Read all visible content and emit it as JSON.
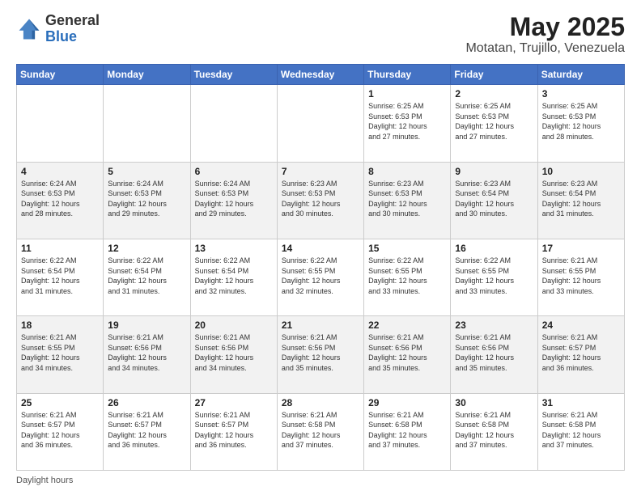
{
  "header": {
    "logo_general": "General",
    "logo_blue": "Blue",
    "title": "May 2025",
    "subtitle": "Motatan, Trujillo, Venezuela"
  },
  "days_of_week": [
    "Sunday",
    "Monday",
    "Tuesday",
    "Wednesday",
    "Thursday",
    "Friday",
    "Saturday"
  ],
  "weeks": [
    [
      {
        "day": "",
        "info": ""
      },
      {
        "day": "",
        "info": ""
      },
      {
        "day": "",
        "info": ""
      },
      {
        "day": "",
        "info": ""
      },
      {
        "day": "1",
        "info": "Sunrise: 6:25 AM\nSunset: 6:53 PM\nDaylight: 12 hours\nand 27 minutes."
      },
      {
        "day": "2",
        "info": "Sunrise: 6:25 AM\nSunset: 6:53 PM\nDaylight: 12 hours\nand 27 minutes."
      },
      {
        "day": "3",
        "info": "Sunrise: 6:25 AM\nSunset: 6:53 PM\nDaylight: 12 hours\nand 28 minutes."
      }
    ],
    [
      {
        "day": "4",
        "info": "Sunrise: 6:24 AM\nSunset: 6:53 PM\nDaylight: 12 hours\nand 28 minutes."
      },
      {
        "day": "5",
        "info": "Sunrise: 6:24 AM\nSunset: 6:53 PM\nDaylight: 12 hours\nand 29 minutes."
      },
      {
        "day": "6",
        "info": "Sunrise: 6:24 AM\nSunset: 6:53 PM\nDaylight: 12 hours\nand 29 minutes."
      },
      {
        "day": "7",
        "info": "Sunrise: 6:23 AM\nSunset: 6:53 PM\nDaylight: 12 hours\nand 30 minutes."
      },
      {
        "day": "8",
        "info": "Sunrise: 6:23 AM\nSunset: 6:53 PM\nDaylight: 12 hours\nand 30 minutes."
      },
      {
        "day": "9",
        "info": "Sunrise: 6:23 AM\nSunset: 6:54 PM\nDaylight: 12 hours\nand 30 minutes."
      },
      {
        "day": "10",
        "info": "Sunrise: 6:23 AM\nSunset: 6:54 PM\nDaylight: 12 hours\nand 31 minutes."
      }
    ],
    [
      {
        "day": "11",
        "info": "Sunrise: 6:22 AM\nSunset: 6:54 PM\nDaylight: 12 hours\nand 31 minutes."
      },
      {
        "day": "12",
        "info": "Sunrise: 6:22 AM\nSunset: 6:54 PM\nDaylight: 12 hours\nand 31 minutes."
      },
      {
        "day": "13",
        "info": "Sunrise: 6:22 AM\nSunset: 6:54 PM\nDaylight: 12 hours\nand 32 minutes."
      },
      {
        "day": "14",
        "info": "Sunrise: 6:22 AM\nSunset: 6:55 PM\nDaylight: 12 hours\nand 32 minutes."
      },
      {
        "day": "15",
        "info": "Sunrise: 6:22 AM\nSunset: 6:55 PM\nDaylight: 12 hours\nand 33 minutes."
      },
      {
        "day": "16",
        "info": "Sunrise: 6:22 AM\nSunset: 6:55 PM\nDaylight: 12 hours\nand 33 minutes."
      },
      {
        "day": "17",
        "info": "Sunrise: 6:21 AM\nSunset: 6:55 PM\nDaylight: 12 hours\nand 33 minutes."
      }
    ],
    [
      {
        "day": "18",
        "info": "Sunrise: 6:21 AM\nSunset: 6:55 PM\nDaylight: 12 hours\nand 34 minutes."
      },
      {
        "day": "19",
        "info": "Sunrise: 6:21 AM\nSunset: 6:56 PM\nDaylight: 12 hours\nand 34 minutes."
      },
      {
        "day": "20",
        "info": "Sunrise: 6:21 AM\nSunset: 6:56 PM\nDaylight: 12 hours\nand 34 minutes."
      },
      {
        "day": "21",
        "info": "Sunrise: 6:21 AM\nSunset: 6:56 PM\nDaylight: 12 hours\nand 35 minutes."
      },
      {
        "day": "22",
        "info": "Sunrise: 6:21 AM\nSunset: 6:56 PM\nDaylight: 12 hours\nand 35 minutes."
      },
      {
        "day": "23",
        "info": "Sunrise: 6:21 AM\nSunset: 6:56 PM\nDaylight: 12 hours\nand 35 minutes."
      },
      {
        "day": "24",
        "info": "Sunrise: 6:21 AM\nSunset: 6:57 PM\nDaylight: 12 hours\nand 36 minutes."
      }
    ],
    [
      {
        "day": "25",
        "info": "Sunrise: 6:21 AM\nSunset: 6:57 PM\nDaylight: 12 hours\nand 36 minutes."
      },
      {
        "day": "26",
        "info": "Sunrise: 6:21 AM\nSunset: 6:57 PM\nDaylight: 12 hours\nand 36 minutes."
      },
      {
        "day": "27",
        "info": "Sunrise: 6:21 AM\nSunset: 6:57 PM\nDaylight: 12 hours\nand 36 minutes."
      },
      {
        "day": "28",
        "info": "Sunrise: 6:21 AM\nSunset: 6:58 PM\nDaylight: 12 hours\nand 37 minutes."
      },
      {
        "day": "29",
        "info": "Sunrise: 6:21 AM\nSunset: 6:58 PM\nDaylight: 12 hours\nand 37 minutes."
      },
      {
        "day": "30",
        "info": "Sunrise: 6:21 AM\nSunset: 6:58 PM\nDaylight: 12 hours\nand 37 minutes."
      },
      {
        "day": "31",
        "info": "Sunrise: 6:21 AM\nSunset: 6:58 PM\nDaylight: 12 hours\nand 37 minutes."
      }
    ]
  ],
  "footer": {
    "label": "Daylight hours"
  }
}
